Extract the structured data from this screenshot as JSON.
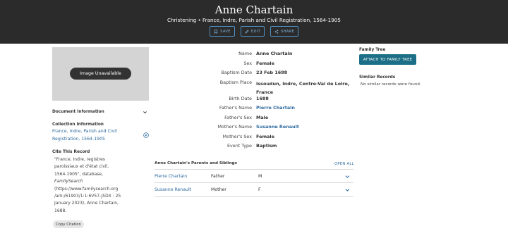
{
  "header": {
    "title": "Anne Chartain",
    "subtitle": "Christening • France, Indre, Parish and Civil Registration, 1564-1905",
    "buttons": {
      "save": "SAVE",
      "edit": "EDIT",
      "share": "SHARE"
    }
  },
  "image": {
    "label": "Image Unavailable"
  },
  "left": {
    "document_information": "Document Information",
    "collection_information": "Collection Information",
    "collection_link_line1": "France, Indre, Parish and Civil",
    "collection_link_line2": "Registration, 1564-1905",
    "cite_title": "Cite This Record",
    "cite_lines": [
      "\"France, Indre, registres",
      "paroissiaux et d'état civil,",
      "1564-1905\", database,",
      "FamilySearch",
      "(https://www.familysearch.org",
      "/ark:/61903/1:1:6V57-J5DX : 25",
      "January 2023), Anne Chartain,",
      "1688."
    ],
    "copy_citation": "Copy Citation"
  },
  "record": {
    "name": {
      "label": "Name",
      "value": "Anne Chartain"
    },
    "sex": {
      "label": "Sex",
      "value": "Female"
    },
    "baptism_date": {
      "label": "Baptism Date",
      "value": "23 Feb 1688"
    },
    "baptism_place": {
      "label": "Baptism Place",
      "value_line1": "Issoudun, Indre, Centre-Val de Loire,",
      "value_line2": "France"
    },
    "birth_date": {
      "label": "Birth Date",
      "value": "1688"
    },
    "fathers_name": {
      "label": "Father's Name",
      "value": "Pierre Chartain"
    },
    "fathers_sex": {
      "label": "Father's Sex",
      "value": "Male"
    },
    "mothers_name": {
      "label": "Mother's Name",
      "value": "Susanne Renault"
    },
    "mothers_sex": {
      "label": "Mother's Sex",
      "value": "Female"
    },
    "event_type": {
      "label": "Event Type",
      "value": "Baptism"
    }
  },
  "relatives": {
    "title": "Anne Chartain's Parents and Siblings",
    "open_all": "OPEN ALL",
    "rows": [
      {
        "name": "Pierre Chartain",
        "role": "Father",
        "sex": "M"
      },
      {
        "name": "Susanne Renault",
        "role": "Mother",
        "sex": "F"
      }
    ]
  },
  "right": {
    "family_tree": "Family Tree",
    "attach_button": "ATTACH TO FAMILY TREE",
    "similar_records": "Similar Records",
    "no_similar": "No similar records were found."
  },
  "colors": {
    "header_bg": "#2b2b2b",
    "link": "#2d6a9e",
    "attach_button_bg": "#1c6f86"
  },
  "icons": [
    "bookmark-icon",
    "pencil-icon",
    "share-icon",
    "chevron-down-icon",
    "compass-icon"
  ]
}
